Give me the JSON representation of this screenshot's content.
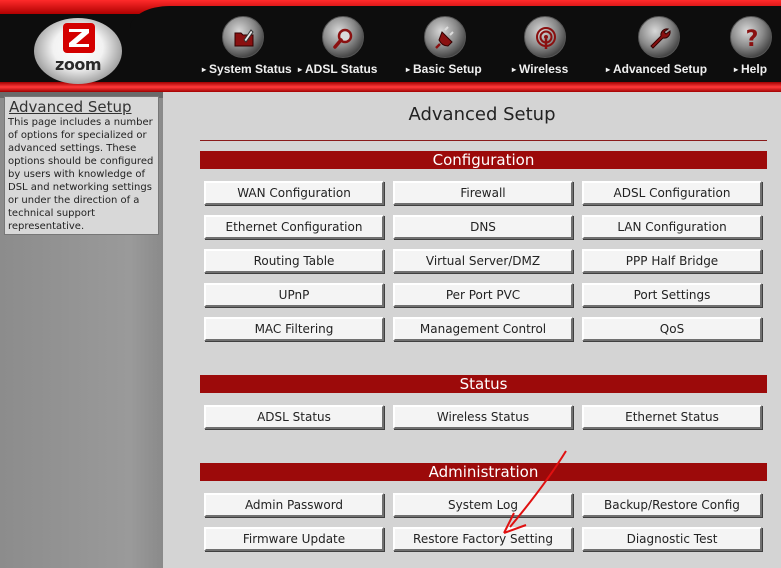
{
  "nav": {
    "items": [
      {
        "label": "System Status",
        "icon": "folder-icon"
      },
      {
        "label": "ADSL Status",
        "icon": "magnifier-icon"
      },
      {
        "label": "Basic Setup",
        "icon": "plug-icon"
      },
      {
        "label": "Wireless",
        "icon": "wireless-icon"
      },
      {
        "label": "Advanced Setup",
        "icon": "wrench-icon"
      },
      {
        "label": "Help",
        "icon": "question-icon"
      }
    ],
    "arrow": "▸"
  },
  "logo": {
    "text": "zoom"
  },
  "sidebar": {
    "title": "Advanced Setup",
    "description": "This page includes a number of options for specialized or advanced settings. These options should be configured by users with knowledge of DSL and networking settings or under the direction of a technical support representative."
  },
  "page": {
    "title": "Advanced Setup"
  },
  "sections": {
    "configuration": {
      "title": "Configuration",
      "buttons": [
        "WAN Configuration",
        "Firewall",
        "ADSL Configuration",
        "Ethernet Configuration",
        "DNS",
        "LAN Configuration",
        "Routing Table",
        "Virtual Server/DMZ",
        "PPP Half Bridge",
        "UPnP",
        "Per Port PVC",
        "Port Settings",
        "MAC Filtering",
        "Management Control",
        "QoS"
      ]
    },
    "status": {
      "title": "Status",
      "buttons": [
        "ADSL Status",
        "Wireless Status",
        "Ethernet Status"
      ]
    },
    "administration": {
      "title": "Administration",
      "buttons": [
        "Admin Password",
        "System Log",
        "Backup/Restore Config",
        "Firmware Update",
        "Restore Factory Setting",
        "Diagnostic Test"
      ]
    }
  },
  "colors": {
    "section_bar": "#9c0a0a",
    "header_red": "#d40000",
    "annotation": "#e01010"
  }
}
